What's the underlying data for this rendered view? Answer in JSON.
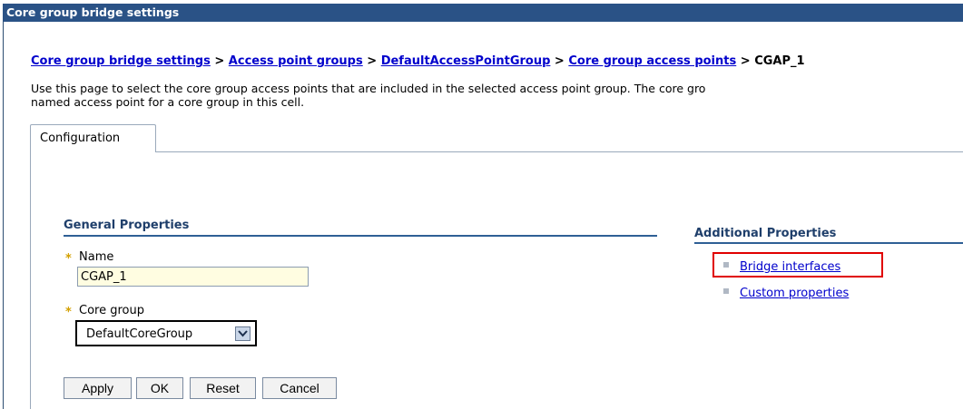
{
  "window": {
    "title": "Core group bridge settings"
  },
  "breadcrumb": {
    "items": [
      "Core group bridge settings",
      "Access point groups",
      "DefaultAccessPointGroup",
      "Core group access points"
    ],
    "current": "CGAP_1",
    "separator": ">"
  },
  "description": {
    "line1": "Use this page to select the core group access points that are included in the selected access point group. The core gro",
    "line2": "named access point for a core group in this cell."
  },
  "tabs": [
    {
      "label": "Configuration"
    }
  ],
  "general_properties": {
    "title": "General Properties",
    "name": {
      "label": "Name",
      "value": "CGAP_1",
      "required_marker": "*"
    },
    "core_group": {
      "label": "Core group",
      "value": "DefaultCoreGroup",
      "required_marker": "*"
    }
  },
  "buttons": {
    "apply": "Apply",
    "ok": "OK",
    "reset": "Reset",
    "cancel": "Cancel"
  },
  "additional_properties": {
    "title": "Additional Properties",
    "links": [
      "Bridge interfaces",
      "Custom properties"
    ]
  },
  "colors": {
    "titlebar": "#2a5286",
    "link": "#0000cc",
    "highlight": "#e00000",
    "required": "#d3a000"
  }
}
